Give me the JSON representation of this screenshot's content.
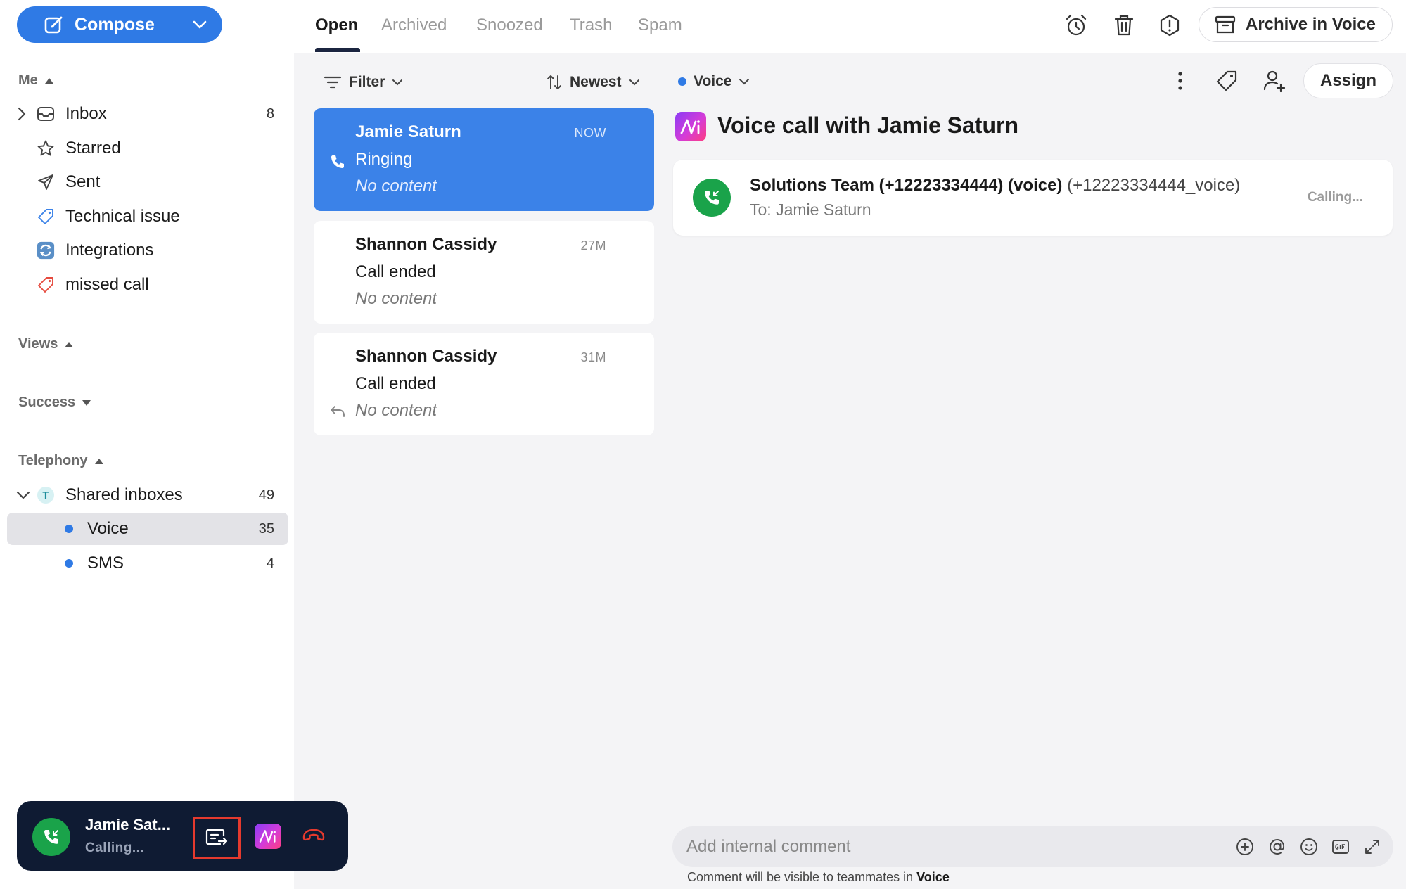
{
  "compose": {
    "label": "Compose"
  },
  "sidebar": {
    "me_label": "Me",
    "items": [
      {
        "label": "Inbox",
        "count": "8"
      },
      {
        "label": "Starred"
      },
      {
        "label": "Sent"
      },
      {
        "label": "Technical issue"
      },
      {
        "label": "Integrations"
      },
      {
        "label": "missed call"
      }
    ],
    "views_label": "Views",
    "success_label": "Success",
    "telephony_label": "Telephony",
    "shared_inboxes": {
      "badge": "T",
      "label": "Shared inboxes",
      "count": "49"
    },
    "sub_items": [
      {
        "label": "Voice",
        "count": "35"
      },
      {
        "label": "SMS",
        "count": "4"
      }
    ]
  },
  "tabs": [
    "Open",
    "Archived",
    "Snoozed",
    "Trash",
    "Spam"
  ],
  "archive_button": "Archive in Voice",
  "list": {
    "filter_label": "Filter",
    "sort_label": "Newest",
    "conversations": [
      {
        "name": "Jamie Saturn",
        "time": "NOW",
        "status": "Ringing",
        "snippet": "No content"
      },
      {
        "name": "Shannon Cassidy",
        "time": "27M",
        "status": "Call ended",
        "snippet": "No content"
      },
      {
        "name": "Shannon Cassidy",
        "time": "31M",
        "status": "Call ended",
        "snippet": "No content"
      }
    ]
  },
  "detail": {
    "inbox_selector": "Voice",
    "assign_label": "Assign",
    "title": "Voice call with Jamie Saturn",
    "call": {
      "from_bold": "Solutions Team (+12223334444) (voice)",
      "from_handle": "(+12223334444_voice)",
      "to": "To: Jamie Saturn",
      "status": "Calling..."
    },
    "comment_placeholder": "Add internal comment",
    "comment_note_prefix": "Comment will be visible to teammates in",
    "comment_note_inbox": "Voice"
  },
  "call_widget": {
    "name": "Jamie Sat...",
    "status": "Calling..."
  },
  "colors": {
    "accent": "#2f7ae5",
    "call_green": "#1aa34a",
    "widget_bg": "#0f1b33",
    "highlight_red": "#e53a2e"
  }
}
